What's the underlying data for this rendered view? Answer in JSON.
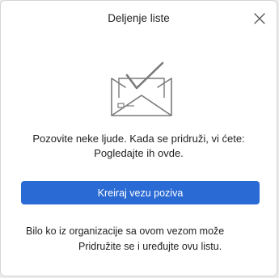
{
  "dialog": {
    "title": "Deljenje liste",
    "close_icon": "close-icon",
    "illustration_icon": "envelope-check-icon",
    "invite_text_line1": "Pozovite neke ljude. Kada se pridruži, vi ćete:",
    "invite_text_line2": "Pogledajte ih ovde.",
    "create_button_label": "Kreiraj vezu poziva",
    "note_line1": "Bilo ko iz organizacije sa ovom vezom može",
    "note_line2": "Pridružite se i uređujte ovu listu."
  },
  "colors": {
    "primary": "#2a6ad4",
    "icon": "#7a7a7a",
    "text": "#1f1f1f"
  }
}
